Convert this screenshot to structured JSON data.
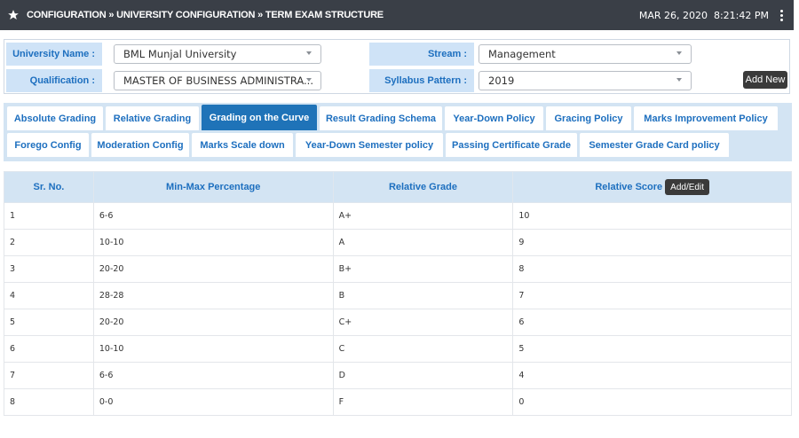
{
  "header": {
    "breadcrumb": "CONFIGURATION » UNIVERSITY CONFIGURATION » TERM EXAM STRUCTURE",
    "datetime": "MAR 26, 2020  8:21:42 PM"
  },
  "form": {
    "university_label": "University Name :",
    "university_value": "BML Munjal University",
    "qualification_label": "Qualification :",
    "qualification_value": "MASTER OF BUSINESS ADMINISTRA...",
    "stream_label": "Stream :",
    "stream_value": "Management",
    "syllabus_label": "Syllabus Pattern :",
    "syllabus_value": "2019",
    "add_new_label": "Add New"
  },
  "tabs": [
    {
      "label": "Absolute Grading",
      "active": false
    },
    {
      "label": "Relative Grading",
      "active": false
    },
    {
      "label": "Grading on the Curve",
      "active": true
    },
    {
      "label": "Result Grading Schema",
      "active": false
    },
    {
      "label": "Year-Down Policy",
      "active": false
    },
    {
      "label": "Gracing Policy",
      "active": false
    },
    {
      "label": "Marks Improvement Policy",
      "active": false
    },
    {
      "label": "Forego Config",
      "active": false
    },
    {
      "label": "Moderation Config",
      "active": false
    },
    {
      "label": "Marks Scale down",
      "active": false
    },
    {
      "label": "Year-Down Semester policy",
      "active": false
    },
    {
      "label": "Passing Certificate Grade",
      "active": false
    },
    {
      "label": "Semester Grade Card policy",
      "active": false
    }
  ],
  "table": {
    "columns": [
      "Sr. No.",
      "Min-Max Percentage",
      "Relative Grade",
      "Relative Score"
    ],
    "add_edit_label": "Add/Edit",
    "rows": [
      [
        "1",
        "6-6",
        "A+",
        "10"
      ],
      [
        "2",
        "10-10",
        "A",
        "9"
      ],
      [
        "3",
        "20-20",
        "B+",
        "8"
      ],
      [
        "4",
        "28-28",
        "B",
        "7"
      ],
      [
        "5",
        "20-20",
        "C+",
        "6"
      ],
      [
        "6",
        "10-10",
        "C",
        "5"
      ],
      [
        "7",
        "6-6",
        "D",
        "4"
      ],
      [
        "8",
        "0-0",
        "F",
        "0"
      ]
    ]
  }
}
